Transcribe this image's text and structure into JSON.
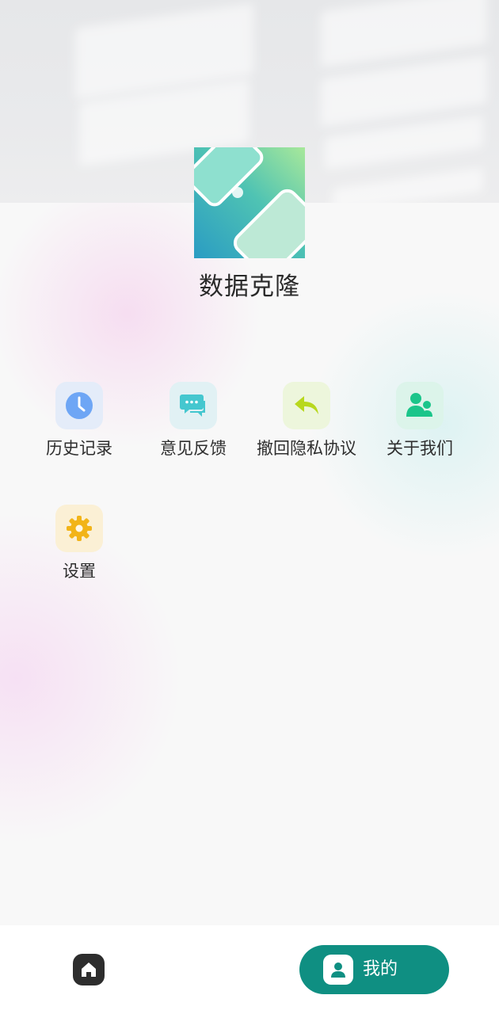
{
  "app": {
    "title": "数据克隆"
  },
  "menu": {
    "items": [
      {
        "label": "历史记录",
        "icon": "clock-icon",
        "color": "#6ea6f5"
      },
      {
        "label": "意见反馈",
        "icon": "chat-bubble-icon",
        "color": "#45c7cf"
      },
      {
        "label": "撤回隐私协议",
        "icon": "reply-arrow-icon",
        "color": "#b8d81e"
      },
      {
        "label": "关于我们",
        "icon": "people-icon",
        "color": "#1bc58a"
      },
      {
        "label": "设置",
        "icon": "gear-icon",
        "color": "#f2b418"
      }
    ]
  },
  "nav": {
    "home_icon": "home-icon",
    "mine_label": "我的",
    "mine_icon": "person-icon",
    "accent": "#0f8f82"
  }
}
